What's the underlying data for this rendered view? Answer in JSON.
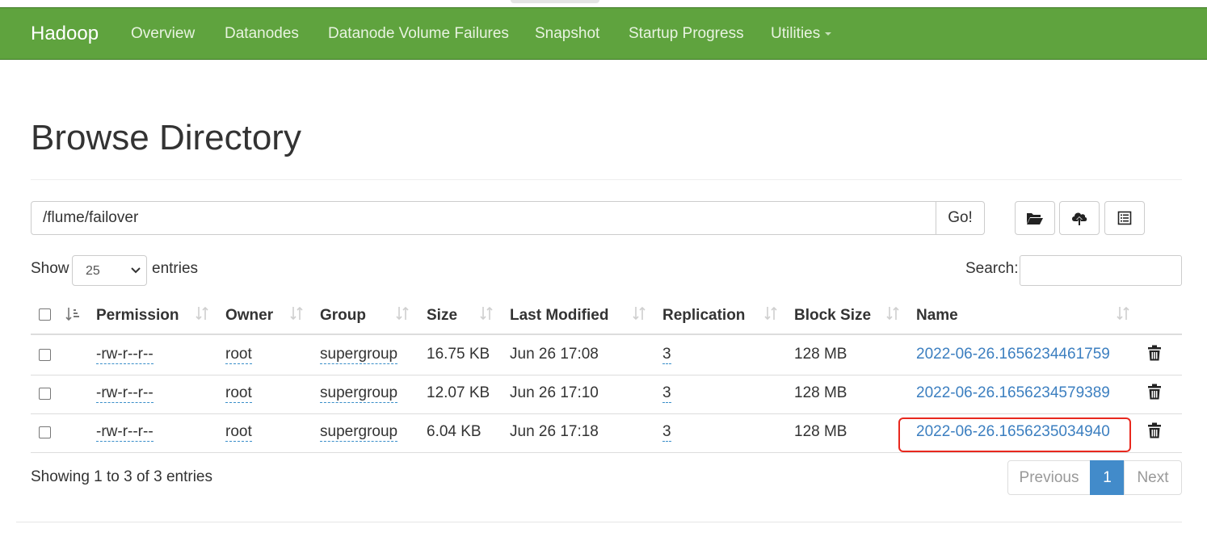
{
  "navbar": {
    "brand": "Hadoop",
    "items": [
      "Overview",
      "Datanodes",
      "Datanode Volume Failures",
      "Snapshot",
      "Startup Progress",
      "Utilities"
    ]
  },
  "page": {
    "title": "Browse Directory"
  },
  "path": {
    "value": "/flume/failover",
    "go_label": "Go!"
  },
  "toolbar": {
    "icons": [
      "folder-open-icon",
      "cloud-upload-icon",
      "list-icon"
    ]
  },
  "table_controls": {
    "show_label": "Show",
    "entries_value": "25",
    "entries_label": "entries",
    "search_label": "Search:"
  },
  "table": {
    "columns": [
      "Permission",
      "Owner",
      "Group",
      "Size",
      "Last Modified",
      "Replication",
      "Block Size",
      "Name"
    ],
    "rows": [
      {
        "permission": "-rw-r--r--",
        "owner": "root",
        "group": "supergroup",
        "size": "16.75 KB",
        "modified": "Jun 26 17:08",
        "replication": "3",
        "block_size": "128 MB",
        "name": "2022-06-26.1656234461759"
      },
      {
        "permission": "-rw-r--r--",
        "owner": "root",
        "group": "supergroup",
        "size": "12.07 KB",
        "modified": "Jun 26 17:10",
        "replication": "3",
        "block_size": "128 MB",
        "name": "2022-06-26.1656234579389"
      },
      {
        "permission": "-rw-r--r--",
        "owner": "root",
        "group": "supergroup",
        "size": "6.04 KB",
        "modified": "Jun 26 17:18",
        "replication": "3",
        "block_size": "128 MB",
        "name": "2022-06-26.1656235034940"
      }
    ]
  },
  "footer": {
    "info": "Showing 1 to 3 of 3 entries",
    "previous": "Previous",
    "current_page": "1",
    "next": "Next"
  },
  "colors": {
    "navbar": "#5fa33e",
    "link": "#3c7fc0",
    "active_page": "#428bca",
    "highlight": "#e8281e"
  }
}
